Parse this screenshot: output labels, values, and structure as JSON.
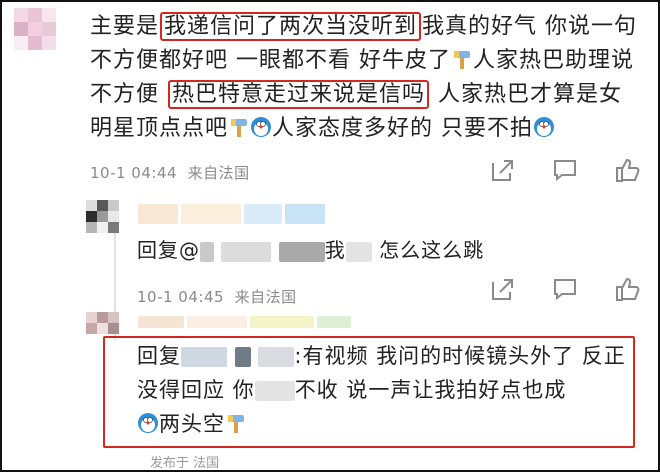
{
  "comment": {
    "text_before": "主要是",
    "highlight1": "我递信问了两次当没听到",
    "text_mid1": "我真的好气 你说一句不方便都好吧 一眼都不看 好牛皮了",
    "text_mid2": "人家热巴助理说不方便",
    "highlight2": "热巴特意走过来说是信吗",
    "text_mid3": "人家热巴才算是女明星顶点点吧",
    "text_mid4": "人家态度多好的 只要不拍",
    "time": "10-1 04:44",
    "location": "来自法国"
  },
  "replies": [
    {
      "prefix": "回复@",
      "text_a": "我",
      "text_b": "怎么这么跳",
      "time": "10-1 04:45",
      "location": "来自法国"
    },
    {
      "prefix": "回复",
      "text_a": ":有视频 我问的时候镜头外了 反正没得回应 你",
      "text_b": "不收 说一声让我拍好点也成",
      "text_c": "两头空",
      "bottom_partial": "发布于 法国"
    }
  ],
  "colors": {
    "highlight_border": "#d5261f",
    "meta_text": "#8a8a8a"
  }
}
